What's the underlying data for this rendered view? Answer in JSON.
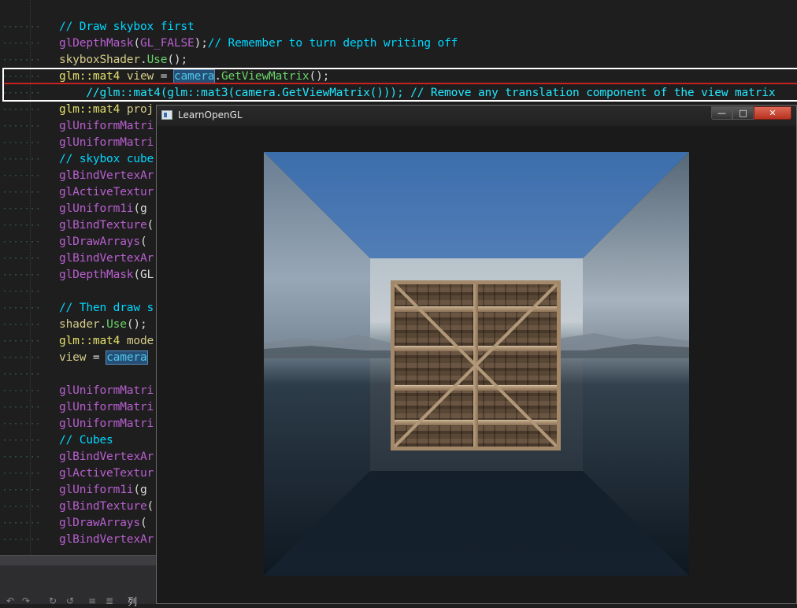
{
  "editor": {
    "lines": [
      {
        "parts": [
          {
            "c": "cm",
            "t": "// Draw skybox first"
          }
        ]
      },
      {
        "parts": [
          {
            "c": "fn",
            "t": "glDepthMask"
          },
          {
            "c": "",
            "t": "("
          },
          {
            "c": "ct",
            "t": "GL_FALSE"
          },
          {
            "c": "",
            "t": ");"
          },
          {
            "c": "cm",
            "t": "// Remember to turn depth writing off"
          }
        ]
      },
      {
        "parts": [
          {
            "c": "id",
            "t": "skyboxShader"
          },
          {
            "c": "",
            "t": "."
          },
          {
            "c": "kw",
            "t": "Use"
          },
          {
            "c": "",
            "t": "();"
          }
        ]
      },
      {
        "parts": [
          {
            "c": "tp",
            "t": "glm::mat4"
          },
          {
            "c": "",
            "t": " "
          },
          {
            "c": "id",
            "t": "view"
          },
          {
            "c": "",
            "t": " = "
          },
          {
            "c": "hl",
            "t": "camera"
          },
          {
            "c": "",
            "t": "."
          },
          {
            "c": "kw",
            "t": "GetViewMatrix"
          },
          {
            "c": "",
            "t": "();"
          }
        ]
      },
      {
        "parts": [
          {
            "c": "cmbright",
            "t": "    //glm::mat4(glm::mat3(camera.GetViewMatrix())); // Remove any translation component of the view matrix"
          }
        ]
      },
      {
        "parts": [
          {
            "c": "tp",
            "t": "glm::mat4"
          },
          {
            "c": "",
            "t": " "
          },
          {
            "c": "id",
            "t": "proj"
          }
        ]
      },
      {
        "parts": [
          {
            "c": "fn",
            "t": "glUniformMatri"
          }
        ]
      },
      {
        "parts": [
          {
            "c": "fn",
            "t": "glUniformMatri"
          }
        ]
      },
      {
        "parts": [
          {
            "c": "cm",
            "t": "// skybox cube"
          }
        ]
      },
      {
        "parts": [
          {
            "c": "fn",
            "t": "glBindVertexAr"
          }
        ]
      },
      {
        "parts": [
          {
            "c": "fn",
            "t": "glActiveTextur"
          }
        ]
      },
      {
        "parts": [
          {
            "c": "fn",
            "t": "glUniform1i"
          },
          {
            "c": "",
            "t": "(g"
          }
        ]
      },
      {
        "parts": [
          {
            "c": "fn",
            "t": "glBindTexture"
          },
          {
            "c": "",
            "t": "("
          }
        ]
      },
      {
        "parts": [
          {
            "c": "fn",
            "t": "glDrawArrays"
          },
          {
            "c": "",
            "t": "("
          }
        ]
      },
      {
        "parts": [
          {
            "c": "fn",
            "t": "glBindVertexAr"
          }
        ]
      },
      {
        "parts": [
          {
            "c": "fn",
            "t": "glDepthMask"
          },
          {
            "c": "",
            "t": "(GL"
          }
        ]
      },
      {
        "parts": []
      },
      {
        "parts": [
          {
            "c": "cm",
            "t": "// Then draw s"
          }
        ]
      },
      {
        "parts": [
          {
            "c": "id",
            "t": "shader"
          },
          {
            "c": "",
            "t": "."
          },
          {
            "c": "kw",
            "t": "Use"
          },
          {
            "c": "",
            "t": "();"
          }
        ]
      },
      {
        "parts": [
          {
            "c": "tp",
            "t": "glm::mat4"
          },
          {
            "c": "",
            "t": " "
          },
          {
            "c": "id",
            "t": "mode"
          }
        ]
      },
      {
        "parts": [
          {
            "c": "id",
            "t": "view"
          },
          {
            "c": "",
            "t": " = "
          },
          {
            "c": "hl",
            "t": "camera"
          }
        ]
      },
      {
        "parts": []
      },
      {
        "parts": [
          {
            "c": "fn",
            "t": "glUniformMatri"
          }
        ]
      },
      {
        "parts": [
          {
            "c": "fn",
            "t": "glUniformMatri"
          }
        ]
      },
      {
        "parts": [
          {
            "c": "fn",
            "t": "glUniformMatri"
          }
        ]
      },
      {
        "parts": [
          {
            "c": "cm",
            "t": "// Cubes"
          }
        ]
      },
      {
        "parts": [
          {
            "c": "fn",
            "t": "glBindVertexAr"
          }
        ]
      },
      {
        "parts": [
          {
            "c": "fn",
            "t": "glActiveTextur"
          }
        ]
      },
      {
        "parts": [
          {
            "c": "fn",
            "t": "glUniform1i"
          },
          {
            "c": "",
            "t": "(g"
          }
        ]
      },
      {
        "parts": [
          {
            "c": "fn",
            "t": "glBindTexture"
          },
          {
            "c": "",
            "t": "("
          }
        ]
      },
      {
        "parts": [
          {
            "c": "fn",
            "t": "glDrawArrays"
          },
          {
            "c": "",
            "t": "("
          }
        ]
      },
      {
        "parts": [
          {
            "c": "fn",
            "t": "glBindVertexAr"
          }
        ]
      }
    ]
  },
  "window": {
    "title": "LearnOpenGL",
    "minimize_icon": "minimize-icon",
    "maximize_icon": "maximize-icon",
    "close_icon": "close-icon",
    "min_glyph": "—",
    "max_glyph": "□",
    "close_glyph": "✕"
  },
  "statusbar": {
    "col_label": "列",
    "icons": [
      "undo-icon",
      "redo-icon",
      "format-icon",
      "comment-icon"
    ]
  },
  "scene": {
    "description_icon": "skybox-scene",
    "object": "wooden-crate"
  }
}
